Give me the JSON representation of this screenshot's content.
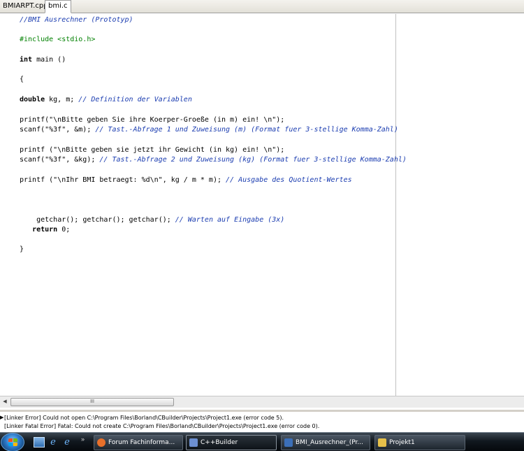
{
  "tabs": [
    {
      "label": "BMIARPT.cpp",
      "active": false
    },
    {
      "label": "bmi.c",
      "active": true
    }
  ],
  "code_lines": [
    {
      "indent": "",
      "parts": [
        {
          "t": "//BMI Ausrechner (Prototyp)",
          "k": "cm"
        }
      ]
    },
    {
      "indent": "",
      "parts": [
        {
          "t": "#include <stdio.h>",
          "k": "pp"
        }
      ]
    },
    {
      "indent": "",
      "parts": [
        {
          "t": "int",
          "k": "kw"
        },
        {
          "t": " main ()",
          "k": ""
        }
      ]
    },
    {
      "indent": "",
      "parts": [
        {
          "t": "{",
          "k": ""
        }
      ]
    },
    {
      "indent": "",
      "parts": [
        {
          "t": "double",
          "k": "kw"
        },
        {
          "t": " kg, m; ",
          "k": ""
        },
        {
          "t": "// Definition der Variablen",
          "k": "cm"
        }
      ]
    },
    {
      "indent": "",
      "parts": [
        {
          "t": "printf(\"\\nBitte geben Sie ihre Koerper-Groeße (in m) ein! \\n\");",
          "k": ""
        }
      ]
    },
    {
      "indent": "",
      "parts": [
        {
          "t": "scanf(\"%3f\", &m); ",
          "k": ""
        },
        {
          "t": "// Tast.-Abfrage 1 und Zuweisung (m) (Format fuer 3-stellige Komma-Zahl)",
          "k": "cm"
        }
      ]
    },
    {
      "indent": "",
      "parts": [
        {
          "t": "printf (\"\\nBitte geben sie jetzt ihr Gewicht (in kg) ein! \\n\");",
          "k": ""
        }
      ]
    },
    {
      "indent": "",
      "parts": [
        {
          "t": "scanf(\"%3f\", &kg); ",
          "k": ""
        },
        {
          "t": "// Tast.-Abfrage 2 und Zuweisung (kg) (Format fuer 3-stellige Komma-Zahl)",
          "k": "cm"
        }
      ]
    },
    {
      "indent": "",
      "parts": [
        {
          "t": "printf (\"\\nIhr BMI betraegt: %d\\n\", kg / m * m); ",
          "k": ""
        },
        {
          "t": "// Ausgabe des Quotient-Wertes",
          "k": "cm"
        }
      ]
    },
    {
      "indent": "    ",
      "parts": [
        {
          "t": "getchar(); getchar(); getchar(); ",
          "k": ""
        },
        {
          "t": "// Warten auf Eingabe (3x)",
          "k": "cm"
        }
      ]
    },
    {
      "indent": "   ",
      "parts": [
        {
          "t": "return",
          "k": "kw"
        },
        {
          "t": " 0;",
          "k": ""
        }
      ]
    },
    {
      "indent": "",
      "parts": [
        {
          "t": "}",
          "k": ""
        }
      ]
    }
  ],
  "scrollbar": {
    "thumb_grip": "III"
  },
  "messages": [
    "[Linker Error] Could not open C:\\Program Files\\Borland\\CBuilder\\Projects\\Project1.exe (error code 5).",
    "[Linker Fatal Error] Fatal: Could not create C:\\Program Files\\Borland\\CBuilder\\Projects\\Project1.exe (error code 0)."
  ],
  "taskbar": {
    "quicklaunch_more": "»",
    "tasks": [
      {
        "label": "Forum Fachinforma...",
        "icon": "firefox-icon",
        "color": "#e8702a"
      },
      {
        "label": "C++Builder",
        "icon": "cbuilder-icon",
        "color": "#6c8fd1"
      },
      {
        "label": "BMI_Ausrechner_(Pr...",
        "icon": "console-window-icon",
        "color": "#3b6fb8"
      },
      {
        "label": "Projekt1",
        "icon": "project-icon",
        "color": "#e6c04a"
      }
    ]
  },
  "colors": {
    "comment": "#1a3cb0",
    "preprocessor": "#008000",
    "keyword": "#000000"
  }
}
